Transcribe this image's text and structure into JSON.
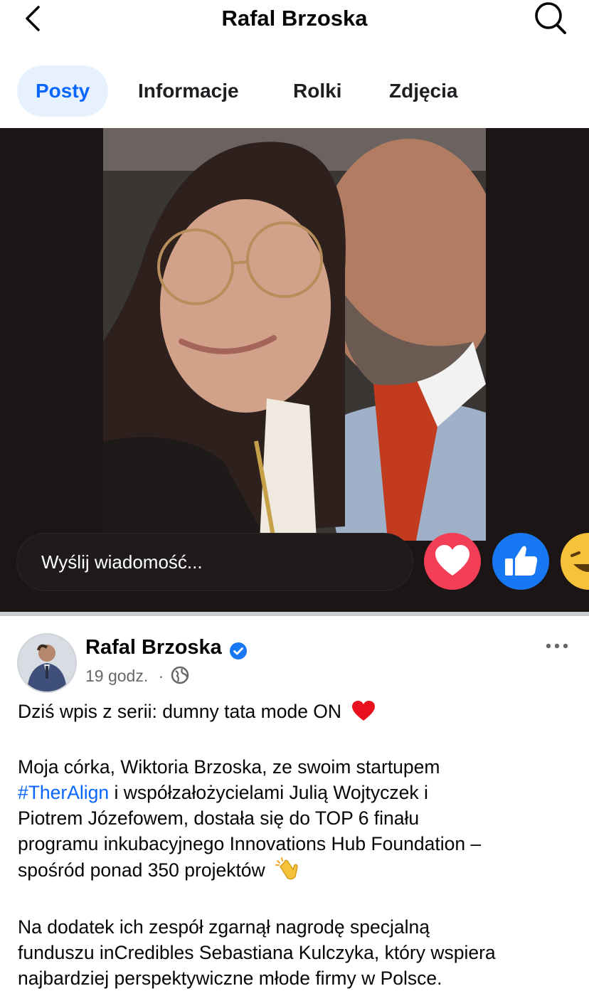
{
  "header": {
    "title": "Rafal Brzoska",
    "back_icon": "chevron-left-icon",
    "search_icon": "search-icon"
  },
  "tabs": [
    {
      "label": "Posty",
      "active": true
    },
    {
      "label": "Informacje",
      "active": false
    },
    {
      "label": "Rolki",
      "active": false
    },
    {
      "label": "Zdjęcia",
      "active": false
    }
  ],
  "story": {
    "message_placeholder": "Wyślij wiadomość...",
    "reactions": [
      "heart-reaction-icon",
      "like-reaction-icon",
      "haha-reaction-icon"
    ]
  },
  "post": {
    "author": "Rafal Brzoska",
    "time": "19 godz.",
    "separator": "·",
    "line1": "Dziś wpis z serii: dumny tata mode ON",
    "p2_a": "Moja córka, Wiktoria Brzoska, ze swoim startupem",
    "hashtag": "#TherAlign",
    "p2_b": " i współzałożycielami Julią Wojtyczek i",
    "p2_c": "Piotrem Józefowem, dostała się do TOP 6 finału",
    "p2_d": "programu inkubacyjnego Innovations Hub Foundation –",
    "p2_e": "spośród ponad 350 projektów",
    "p3_a": "Na dodatek ich zespół zgarnął nagrodę specjalną",
    "p3_b": "funduszu inCredibles Sebastiana Kulczyka, który wspiera",
    "p3_c": "najbardziej perspektywiczne młode firmy w Polsce."
  },
  "colors": {
    "accent": "#0866ff",
    "tab_active_bg": "#e7f0fd",
    "heart": "#f33e58",
    "like": "#1877f2"
  }
}
